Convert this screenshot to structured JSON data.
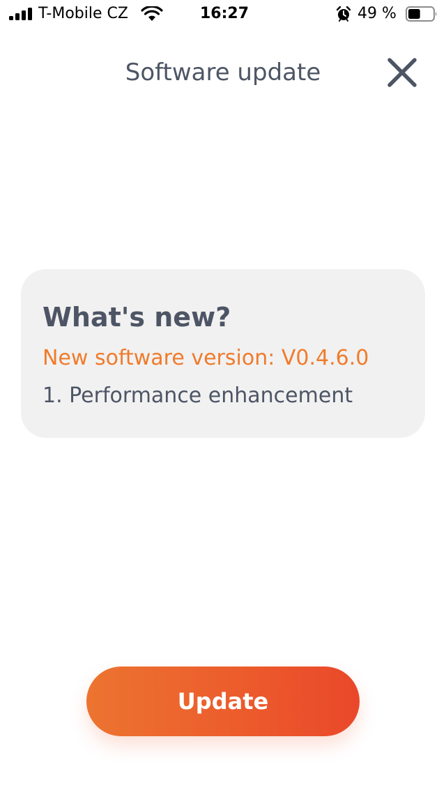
{
  "status_bar": {
    "carrier": "T-Mobile CZ",
    "time": "16:27",
    "battery_percent": "49 %",
    "battery_level": 0.49,
    "icons": [
      "signal-icon",
      "wifi-icon",
      "alarm-icon",
      "battery-icon"
    ]
  },
  "header": {
    "title": "Software update",
    "close_icon": "close-icon"
  },
  "card": {
    "heading": "What's new?",
    "version": "New software version: V0.4.6.0",
    "items": [
      "1. Performance enhancement"
    ]
  },
  "actions": {
    "update_label": "Update"
  },
  "colors": {
    "text_dark": "#4d5565",
    "accent_orange": "#f07b2b",
    "button_gradient_start": "#ec7430",
    "button_gradient_end": "#e9482a",
    "card_background": "#f1f1f1"
  }
}
